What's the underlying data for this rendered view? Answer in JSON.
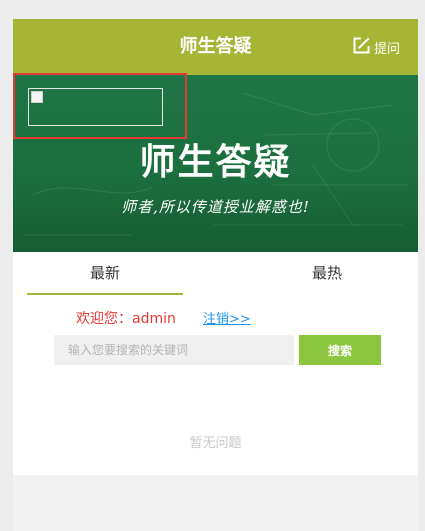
{
  "header": {
    "title": "师生答疑",
    "ask_label": "提问"
  },
  "banner": {
    "title": "师生答疑",
    "subtitle": "师者,所以传道授业解惑也!"
  },
  "tabs": [
    {
      "label": "最新",
      "active": true
    },
    {
      "label": "最热",
      "active": false
    }
  ],
  "user": {
    "welcome": "欢迎您：admin",
    "logout_label": "注销>>"
  },
  "search": {
    "placeholder": "输入您要搜索的关键词",
    "button_label": "搜索"
  },
  "empty_text": "暂无问题",
  "colors": {
    "accent": "#a6b535",
    "chalkboard": "#1c6f3f",
    "search_button": "#8cc63f",
    "welcome_text": "#e53935",
    "link": "#2196f3",
    "highlight_border": "#e53935"
  },
  "icons": {
    "ask": "edit-icon"
  }
}
